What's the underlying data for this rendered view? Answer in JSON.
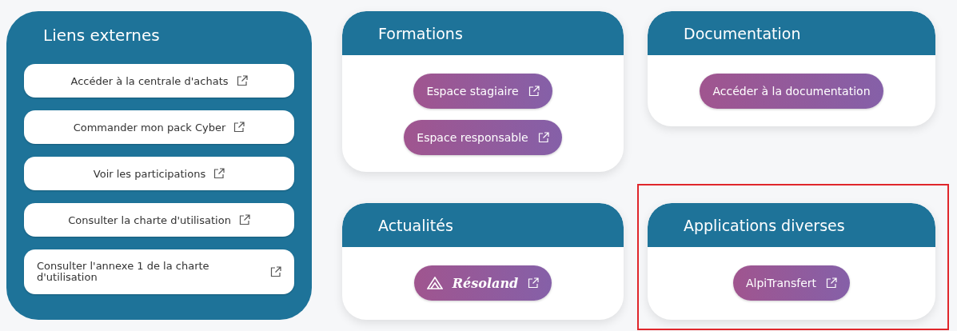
{
  "external_links": {
    "title": "Liens externes",
    "links": [
      {
        "label": "Accéder à la centrale d'achats",
        "kind": "centered"
      },
      {
        "label": "Commander mon pack Cyber",
        "kind": "centered"
      },
      {
        "label": "Voir les participations",
        "kind": "centered"
      },
      {
        "label": "Consulter la charte d'utilisation",
        "kind": "centered"
      },
      {
        "label": "Consulter l'annexe 1 de la charte d'utilisation",
        "kind": "split"
      }
    ]
  },
  "cards": [
    {
      "title": "Formations",
      "highlighted": false,
      "buttons": [
        {
          "label": "Espace stagiaire",
          "kind": "text",
          "external": true
        },
        {
          "label": "Espace responsable",
          "kind": "text",
          "external": true
        }
      ]
    },
    {
      "title": "Documentation",
      "highlighted": false,
      "buttons": [
        {
          "label": "Accéder à la documentation",
          "kind": "text",
          "external": false
        }
      ]
    },
    {
      "title": "Actualités",
      "highlighted": false,
      "buttons": [
        {
          "label": "Résoland",
          "kind": "logo",
          "external": true
        }
      ]
    },
    {
      "title": "Applications diverses",
      "highlighted": true,
      "buttons": [
        {
          "label": "AlpiTransfert",
          "kind": "text",
          "external": true
        }
      ]
    }
  ]
}
